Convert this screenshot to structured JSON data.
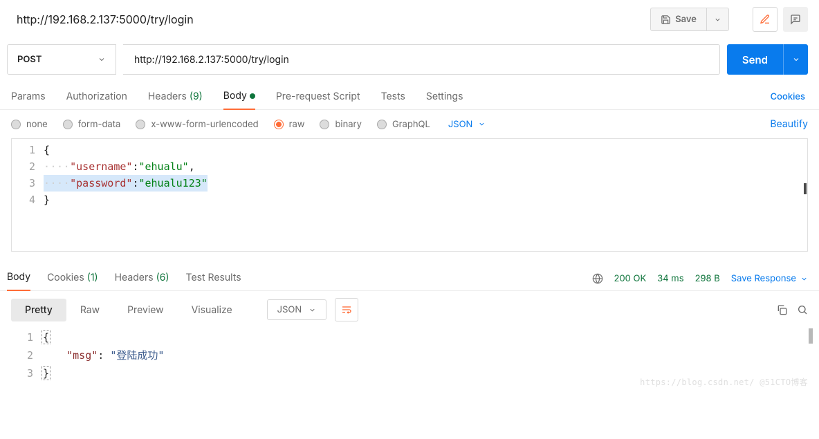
{
  "title": "http://192.168.2.137:5000/try/login",
  "save_label": "Save",
  "request": {
    "method": "POST",
    "url": "http://192.168.2.137:5000/try/login",
    "send_label": "Send"
  },
  "tabs": {
    "params": "Params",
    "auth": "Authorization",
    "headers": "Headers",
    "headers_count": "(9)",
    "body": "Body",
    "prerequest": "Pre-request Script",
    "tests": "Tests",
    "settings": "Settings",
    "cookies_link": "Cookies"
  },
  "body_types": {
    "none": "none",
    "formdata": "form-data",
    "urlencoded": "x-www-form-urlencoded",
    "raw": "raw",
    "binary": "binary",
    "graphql": "GraphQL",
    "lang": "JSON",
    "beautify": "Beautify"
  },
  "request_body": {
    "l1": "{",
    "l2_key": "\"username\"",
    "l2_val": "\"ehualu\"",
    "l3_key": "\"password\"",
    "l3_val": "\"ehualu123\"",
    "l4": "}"
  },
  "resp_tabs": {
    "body": "Body",
    "cookies": "Cookies",
    "cookies_count": "(1)",
    "headers": "Headers",
    "headers_count": "(6)",
    "test": "Test Results"
  },
  "status": {
    "code": "200 OK",
    "time": "34 ms",
    "size": "298 B",
    "save_response": "Save Response"
  },
  "view": {
    "pretty": "Pretty",
    "raw": "Raw",
    "preview": "Preview",
    "visualize": "Visualize",
    "lang": "JSON"
  },
  "response_body": {
    "l1": "{",
    "l2_key": "\"msg\"",
    "l2_sep": ": ",
    "l2_val": "\"登陆成功\"",
    "l3": "}"
  },
  "watermark": "https://blog.csdn.net/ @51CTO博客"
}
